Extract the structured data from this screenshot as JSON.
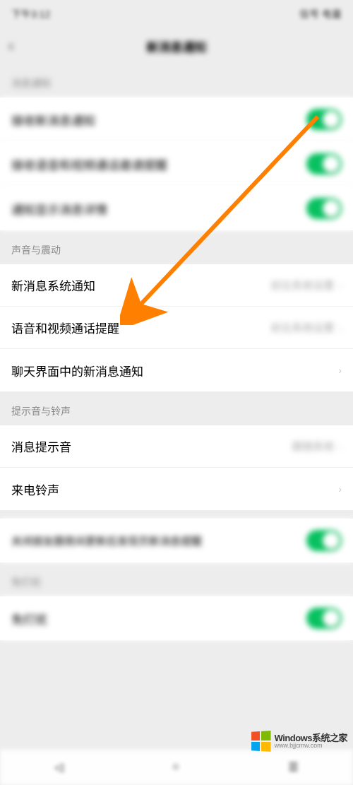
{
  "status": {
    "time": "下午3:12",
    "right": "信号 电量"
  },
  "nav": {
    "title": "新消息通知",
    "back": "‹"
  },
  "section1": {
    "header": "消息通知",
    "rows": [
      {
        "label": "接收新消息通知",
        "toggle": true
      },
      {
        "label": "接收语音和视频通话邀请提醒",
        "toggle": true
      },
      {
        "label": "通知显示消息详情",
        "toggle": true
      }
    ]
  },
  "section2": {
    "header": "声音与震动",
    "rows": [
      {
        "label": "新消息系统通知",
        "value": "前往系统设置"
      },
      {
        "label": "语音和视频通话提醒",
        "value": "前往系统设置"
      },
      {
        "label": "聊天界面中的新消息通知",
        "value": ""
      }
    ]
  },
  "section3": {
    "header": "提示音与铃声",
    "rows": [
      {
        "label": "消息提示音",
        "value": "跟随系统"
      },
      {
        "label": "来电铃声",
        "value": ""
      }
    ]
  },
  "section4": {
    "rows": [
      {
        "label": "关闭朋友圈夜间更新后发现页新消息提醒",
        "toggle": true
      }
    ]
  },
  "section5": {
    "header": "免打扰",
    "rows": [
      {
        "label": "免打扰",
        "toggle": true
      }
    ]
  },
  "watermark": {
    "line1": "Windows系统之家",
    "line2": "www.bjjcmw.com"
  }
}
